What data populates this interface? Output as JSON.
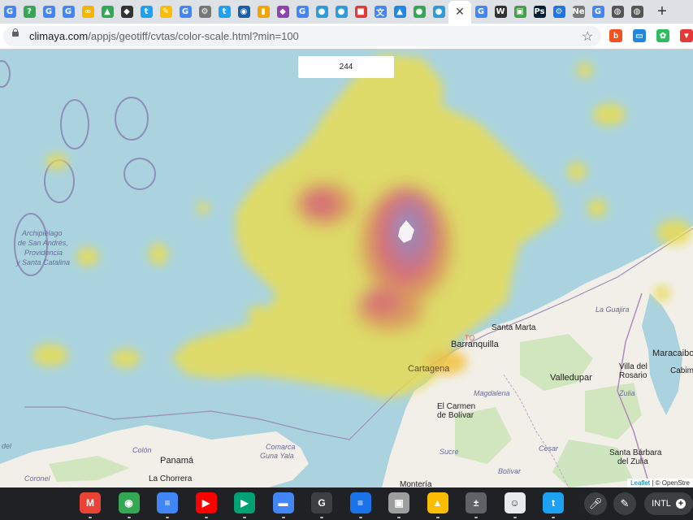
{
  "browser": {
    "tabs": [
      {
        "name": "tab-google-1",
        "icon": "google-icon",
        "glyph": "G",
        "color": "#4285f4"
      },
      {
        "name": "tab-google-2",
        "icon": "green-help-icon",
        "glyph": "?",
        "color": "#34a853"
      },
      {
        "name": "tab-google-3",
        "icon": "google-icon",
        "glyph": "G",
        "color": "#4285f4"
      },
      {
        "name": "tab-google-4",
        "icon": "google-icon",
        "glyph": "G",
        "color": "#4285f4"
      },
      {
        "name": "tab-infinity",
        "icon": "infinity-icon",
        "glyph": "∞",
        "color": "#f4b400"
      },
      {
        "name": "tab-drive",
        "icon": "drive-icon",
        "glyph": "▲",
        "color": "#34a853"
      },
      {
        "name": "tab-shield",
        "icon": "shield-icon",
        "glyph": "◆",
        "color": "#333333"
      },
      {
        "name": "tab-twitter-1",
        "icon": "twitter-icon",
        "glyph": "t",
        "color": "#1da1f2"
      },
      {
        "name": "tab-pencil",
        "icon": "pencil-icon",
        "glyph": "✎",
        "color": "#fbbc04"
      },
      {
        "name": "tab-google-5",
        "icon": "google-icon",
        "glyph": "G",
        "color": "#4285f4"
      },
      {
        "name": "tab-gear",
        "icon": "gear-globe-icon",
        "glyph": "⚙",
        "color": "#777777"
      },
      {
        "name": "tab-twitter-2",
        "icon": "twitter-icon",
        "glyph": "t",
        "color": "#1da1f2"
      },
      {
        "name": "tab-noaa",
        "icon": "noaa-icon",
        "glyph": "◉",
        "color": "#1a5ea8"
      },
      {
        "name": "tab-chart",
        "icon": "bar-chart-icon",
        "glyph": "▮",
        "color": "#f4a400"
      },
      {
        "name": "tab-cube",
        "icon": "cube-icon",
        "glyph": "◆",
        "color": "#8e44ad"
      },
      {
        "name": "tab-google-6",
        "icon": "google-icon",
        "glyph": "G",
        "color": "#4285f4"
      },
      {
        "name": "tab-circle-1",
        "icon": "blue-circle-icon",
        "glyph": "●",
        "color": "#2d9cdb"
      },
      {
        "name": "tab-circle-2",
        "icon": "blue-circle-icon",
        "glyph": "●",
        "color": "#2d9cdb"
      },
      {
        "name": "tab-red",
        "icon": "red-square-icon",
        "glyph": "■",
        "color": "#e53935"
      },
      {
        "name": "tab-translate",
        "icon": "translate-icon",
        "glyph": "文",
        "color": "#4285f4"
      },
      {
        "name": "tab-mountain",
        "icon": "mountain-icon",
        "glyph": "▲",
        "color": "#1e88e5"
      },
      {
        "name": "tab-maps",
        "icon": "maps-pin-icon",
        "glyph": "●",
        "color": "#34a853"
      },
      {
        "name": "tab-circle-3",
        "icon": "blue-circle-icon",
        "glyph": "●",
        "color": "#2d9cdb"
      }
    ],
    "active_tab": {
      "name": "tab-climaya",
      "icon": "close-icon",
      "glyph": "✕"
    },
    "tabs_after": [
      {
        "name": "tab-google-7",
        "icon": "google-icon",
        "glyph": "G",
        "color": "#4285f4"
      },
      {
        "name": "tab-wikipedia",
        "icon": "wikipedia-icon",
        "glyph": "W",
        "color": "#333333"
      },
      {
        "name": "tab-photo",
        "icon": "photo-icon",
        "glyph": "▣",
        "color": "#43a047"
      },
      {
        "name": "tab-ps",
        "icon": "photoshop-icon",
        "glyph": "Ps",
        "color": "#001e36"
      },
      {
        "name": "tab-settings",
        "icon": "gear-icon",
        "glyph": "⚙",
        "color": "#1a73e8"
      },
      {
        "name": "tab-ne",
        "icon": "ne-icon",
        "glyph": "Ne",
        "color": "#777777"
      },
      {
        "name": "tab-google-8",
        "icon": "google-icon",
        "glyph": "G",
        "color": "#4285f4"
      },
      {
        "name": "tab-globe-1",
        "icon": "globe-icon",
        "glyph": "◍",
        "color": "#555555"
      },
      {
        "name": "tab-globe-2",
        "icon": "globe-icon",
        "glyph": "◍",
        "color": "#555555"
      }
    ],
    "new_tab_label": "+",
    "url_domain": "climaya.com",
    "url_path": "/appjs/geotiff/cvtas/color-scale.html?min=100",
    "extensions": [
      {
        "name": "extension-b",
        "icon": "b-circle-icon",
        "glyph": "b",
        "color": "#f4511e"
      },
      {
        "name": "extension-photos",
        "icon": "photos-icon",
        "glyph": "▭",
        "color": "#1e88e5"
      },
      {
        "name": "extension-evernote",
        "icon": "evernote-icon",
        "glyph": "✿",
        "color": "#2dbe60"
      },
      {
        "name": "extension-shield",
        "icon": "shield-ext-icon",
        "glyph": "▼",
        "color": "#e53935"
      }
    ]
  },
  "map": {
    "value_display": "244",
    "labels": {
      "archipelago_1": "Archipiélago",
      "archipelago_2": "de San Andrés,",
      "archipelago_3": "Providencia",
      "archipelago_4": "y Santa Catalina",
      "la_guajira": "La Guajira",
      "santa_marta": "Santa Marta",
      "barranquilla": "Barranquilla",
      "cartagena": "Cartagena",
      "valledupar": "Valledupar",
      "maracaibo": "Maracaibo",
      "villa_del_rosario_1": "Villa del",
      "villa_del_rosario_2": "Rosario",
      "cabimas": "Cabima",
      "zulia": "Zulia",
      "magdalena": "Magdalena",
      "el_carmen_1": "El Carmen",
      "el_carmen_2": "de Bolívar",
      "sucre": "Sucre",
      "cesar": "Cesar",
      "bolivar": "Bolívar",
      "santa_barbara_1": "Santa Bárbara",
      "santa_barbara_2": "del Zulia",
      "colon": "Colón",
      "panama": "Panamá",
      "comarca_1": "Comarca",
      "comarca_2": "Guna Yala",
      "la_chorrera": "La Chorrera",
      "coronel": "Coronel",
      "del": "del",
      "montoria": "Montería",
      "to": "TO"
    },
    "attribution_leaflet": "Leaflet",
    "attribution_rest": " | © OpenStre"
  },
  "shelf": {
    "apps": [
      {
        "name": "gmail-app",
        "icon": "gmail-icon",
        "glyph": "M",
        "color": "#ea4335"
      },
      {
        "name": "chrome-app",
        "icon": "chrome-icon",
        "glyph": "◉",
        "color": "#34a853"
      },
      {
        "name": "docs-app",
        "icon": "docs-icon",
        "glyph": "≡",
        "color": "#4285f4"
      },
      {
        "name": "youtube-app",
        "icon": "youtube-icon",
        "glyph": "▶",
        "color": "#ff0000"
      },
      {
        "name": "play-store-app",
        "icon": "play-store-icon",
        "glyph": "▶",
        "color": "#00a173"
      },
      {
        "name": "files-app",
        "icon": "files-icon",
        "glyph": "▬",
        "color": "#4285f4"
      },
      {
        "name": "g-app",
        "icon": "g-box-icon",
        "glyph": "G",
        "color": "#3c4043"
      },
      {
        "name": "messages-app",
        "icon": "messages-icon",
        "glyph": "≡",
        "color": "#1a73e8"
      },
      {
        "name": "screenshot-app",
        "icon": "screenshot-icon",
        "glyph": "▣",
        "color": "#9e9e9e"
      },
      {
        "name": "drive-app",
        "icon": "drive-icon",
        "glyph": "▲",
        "color": "#fbbc04"
      },
      {
        "name": "calculator-app",
        "icon": "calculator-icon",
        "glyph": "±",
        "color": "#5f6368"
      },
      {
        "name": "clock-app",
        "icon": "face-icon",
        "glyph": "☺",
        "color": "#e8eaed"
      },
      {
        "name": "twitter-app",
        "icon": "twitter-icon",
        "glyph": "t",
        "color": "#1da1f2"
      }
    ],
    "tray_input_label": "INTL"
  }
}
